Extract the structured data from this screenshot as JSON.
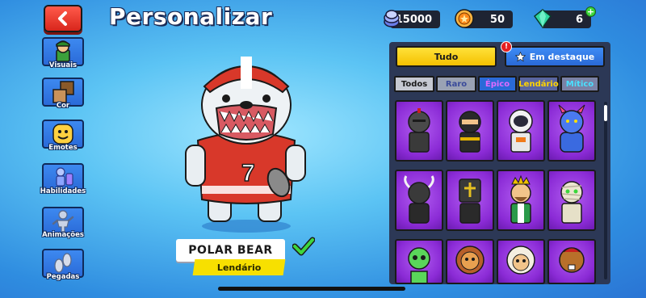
{
  "header": {
    "title": "Personalizar",
    "back_icon": "chevron-left-icon"
  },
  "currencies": {
    "coins": {
      "value": "15000",
      "icon": "coins-icon"
    },
    "trophies": {
      "value": "50",
      "icon": "trophy-icon"
    },
    "gems": {
      "value": "6",
      "icon": "gem-icon"
    }
  },
  "sidebar": {
    "items": [
      {
        "label": "Visuais",
        "icon": "character-icon"
      },
      {
        "label": "Cor",
        "icon": "color-swatch-icon"
      },
      {
        "label": "Emotes",
        "icon": "smiley-icon"
      },
      {
        "label": "Habilidades",
        "icon": "abilities-icon"
      },
      {
        "label": "Animações",
        "icon": "animation-icon"
      },
      {
        "label": "Pegadas",
        "icon": "footprints-icon"
      }
    ]
  },
  "character": {
    "name": "POLAR BEAR",
    "rarity": "Lendário",
    "jersey_number": "7",
    "equipped_icon": "checkmark-icon"
  },
  "panel": {
    "filter_all": "Tudo",
    "filter_featured": "Em destaque",
    "alert": "!",
    "tabs": [
      "Todos",
      "Raro",
      "Épico",
      "Lendário",
      "Mítico"
    ]
  },
  "colors": {
    "accent_yellow": "#f4c000",
    "accent_blue": "#2a69d6",
    "epic_purple": "#8b2bd6",
    "back_red": "#d8261c"
  }
}
